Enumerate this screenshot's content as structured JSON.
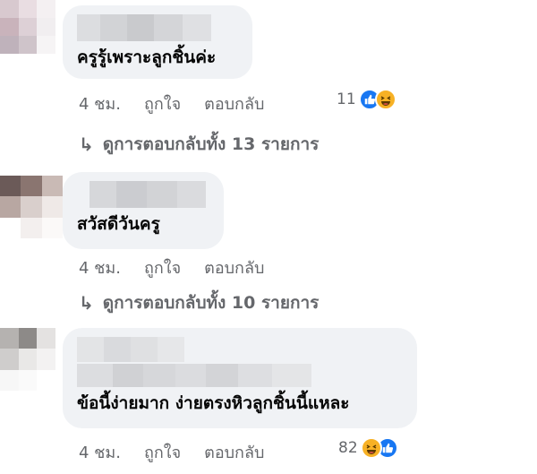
{
  "comments": [
    {
      "text": "ครูรู้เพราะลูกชิ้นค่ะ",
      "time": "4 ชม.",
      "like_label": "ถูกใจ",
      "reply_label": "ตอบกลับ",
      "reaction_count": "11",
      "reactions": [
        "like-icon",
        "haha-icon"
      ],
      "view_replies": "ดูการตอบกลับทั้ง 13 รายการ"
    },
    {
      "text": "สวัสดีวันครู",
      "time": "4 ชม.",
      "like_label": "ถูกใจ",
      "reply_label": "ตอบกลับ",
      "view_replies": "ดูการตอบกลับทั้ง 10 รายการ"
    },
    {
      "text": "ข้อนี้ง่ายมาก ง่ายตรงหิวลูกชิ้นนี้แหละ",
      "time": "4 ชม.",
      "like_label": "ถูกใจ",
      "reply_label": "ตอบกลับ",
      "reaction_count": "82",
      "reactions": [
        "haha-icon",
        "like-icon"
      ]
    }
  ],
  "colors": {
    "bubble": "#f0f2f5",
    "meta_text": "#65676b",
    "like_blue": "#1877f2",
    "haha_yellow": "#f7b125"
  }
}
